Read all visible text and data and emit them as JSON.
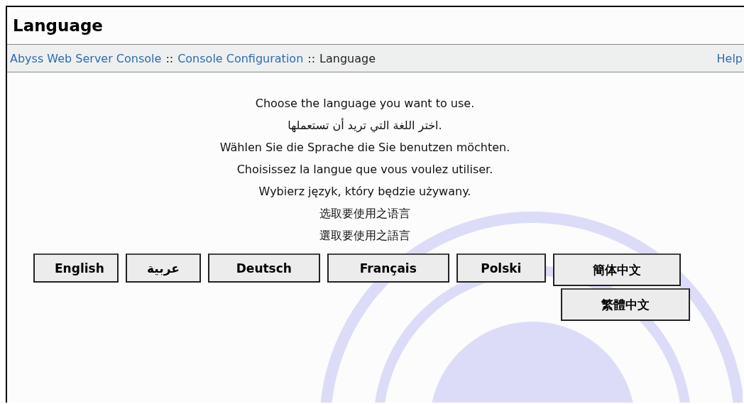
{
  "page_title": "Language",
  "breadcrumb": {
    "items": [
      {
        "label": "Abyss Web Server Console",
        "kind": "link"
      },
      {
        "label": "::",
        "kind": "separator"
      },
      {
        "label": "Console Configuration",
        "kind": "link"
      },
      {
        "label": "::",
        "kind": "separator"
      },
      {
        "label": "Language",
        "kind": "current"
      }
    ],
    "help": "Help"
  },
  "instructions": [
    "Choose the language you want to use.",
    "اختر اللغة التي تريد أن تستعملها.",
    "Wählen Sie die Sprache die Sie benutzen möchten.",
    "Choisissez la langue que vous voulez utiliser.",
    "Wybierz język, który będzie używany.",
    "选取要使用之语言",
    "選取要使用之語言"
  ],
  "language_buttons": [
    [
      "English",
      "عربية",
      "Deutsch",
      "Français",
      "Polski",
      "簡体中文"
    ],
    [
      "繁體中文"
    ]
  ]
}
